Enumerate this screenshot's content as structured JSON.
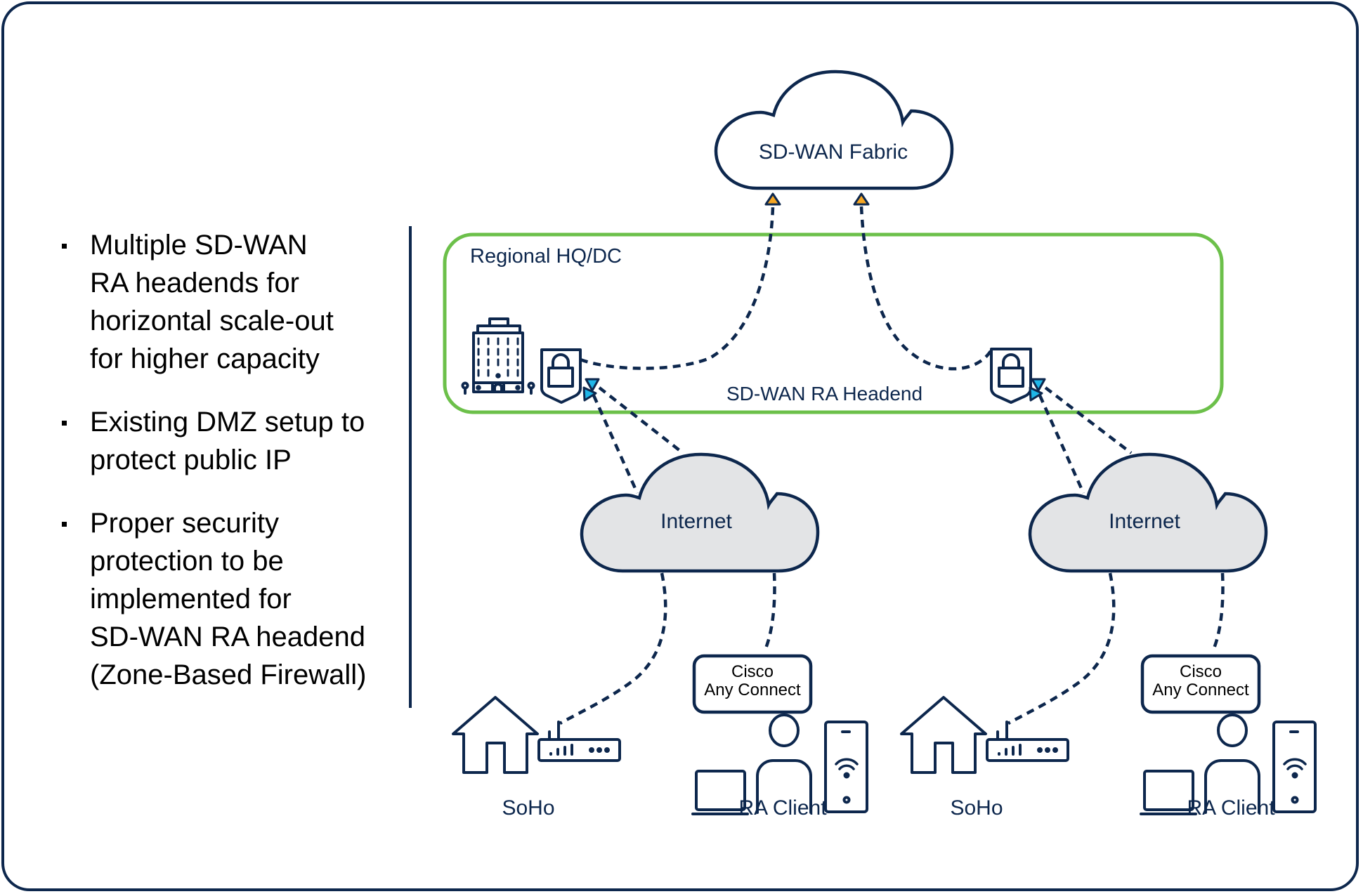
{
  "bullets": [
    {
      "lines": [
        "Multiple SD-WAN",
        "RA headends for",
        "horizontal scale-out",
        "for higher capacity"
      ]
    },
    {
      "lines": [
        "Existing DMZ setup to",
        "protect public IP"
      ]
    },
    {
      "lines": [
        "Proper security",
        "protection to be",
        "implemented for",
        "SD-WAN RA headend",
        "(Zone-Based Firewall)"
      ]
    }
  ],
  "diagram": {
    "fabric_cloud": {
      "label": "SD-WAN Fabric",
      "icon": "cloud-icon"
    },
    "regional_box": {
      "label": "Regional HQ/DC",
      "headend_label": "SD-WAN RA Headend"
    },
    "icons": {
      "building": "building-icon",
      "firewall": "shield-lock-icon",
      "house": "house-icon",
      "router": "router-icon",
      "laptop": "laptop-icon",
      "person": "person-icon",
      "phone": "mobile-phone-icon"
    },
    "sites": [
      {
        "internet_label": "Internet",
        "soho_label": "SoHo",
        "client_label": "RA Client",
        "client_app": [
          "Cisco",
          "Any Connect"
        ]
      },
      {
        "internet_label": "Internet",
        "soho_label": "SoHo",
        "client_label": "RA Client",
        "client_app": [
          "Cisco",
          "Any Connect"
        ]
      }
    ],
    "colors": {
      "navy": "#0d274d",
      "green": "#6cc04a",
      "orange_arrow": "#f5a623",
      "blue_arrow": "#1fb6e8",
      "internet_fill": "#e3e4e6"
    }
  }
}
